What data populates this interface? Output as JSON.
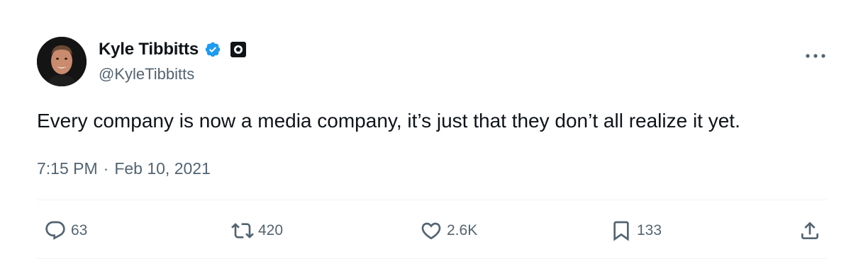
{
  "author": {
    "name": "Kyle Tibbitts",
    "handle": "@KyleTibbitts",
    "verified": true,
    "verified_color": "#1d9bf0"
  },
  "tweet": {
    "text": "Every company is now a media company, it’s just that they don’t all realize it yet.",
    "time": "7:15 PM",
    "separator": "·",
    "date": "Feb 10, 2021"
  },
  "actions": {
    "replies": "63",
    "retweets": "420",
    "likes": "2.6K",
    "bookmarks": "133"
  },
  "icons": {
    "more": "more-horizontal-icon",
    "reply": "reply-icon",
    "retweet": "retweet-icon",
    "like": "heart-icon",
    "bookmark": "bookmark-icon",
    "share": "share-icon"
  },
  "colors": {
    "text_primary": "#0f1419",
    "text_secondary": "#536471",
    "divider": "#eff3f4"
  }
}
